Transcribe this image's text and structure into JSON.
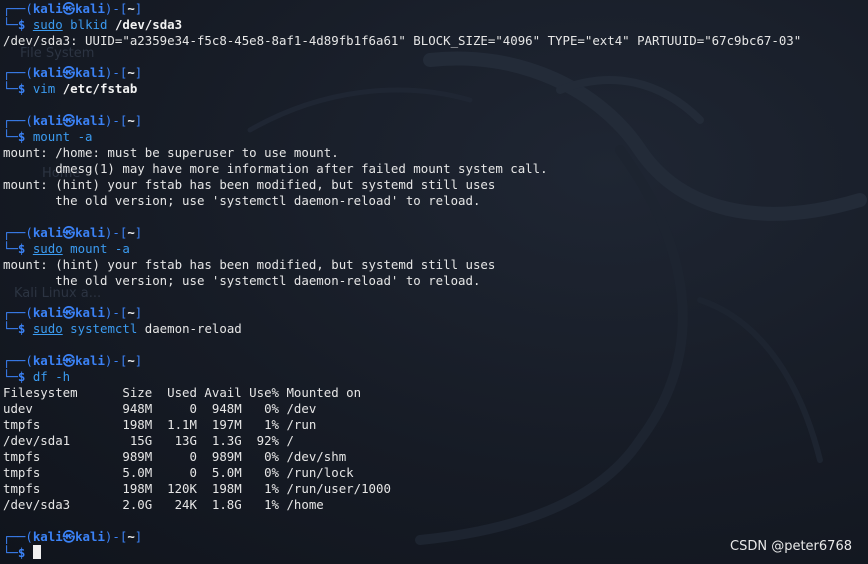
{
  "prompt": {
    "user": "kali",
    "host": "kali",
    "cwd": "~",
    "at": "㉿"
  },
  "ghost_desktop": {
    "icon_label_1": "File System",
    "icon_label_2": "Home",
    "icon_label_3": "Kali Linux a..."
  },
  "blocks": [
    {
      "sudo": "sudo",
      "cmd": "blkid",
      "arg": "/dev/sda3",
      "output": [
        "/dev/sda3: UUID=\"a2359e34-f5c8-45e8-8af1-4d89fb1f6a61\" BLOCK_SIZE=\"4096\" TYPE=\"ext4\" PARTUUID=\"67c9bc67-03\""
      ]
    },
    {
      "sudo": "",
      "cmd": "vim",
      "arg": "/etc/fstab",
      "output": []
    },
    {
      "sudo": "",
      "cmd": "mount -a",
      "arg": "",
      "output": [
        "mount: /home: must be superuser to use mount.",
        "       dmesg(1) may have more information after failed mount system call.",
        "mount: (hint) your fstab has been modified, but systemd still uses",
        "       the old version; use 'systemctl daemon-reload' to reload."
      ]
    },
    {
      "sudo": "sudo",
      "cmd": "mount -a",
      "arg": "",
      "output": [
        "mount: (hint) your fstab has been modified, but systemd still uses",
        "       the old version; use 'systemctl daemon-reload' to reload."
      ]
    },
    {
      "sudo": "sudo",
      "cmd": "systemctl",
      "arg": "daemon-reload",
      "arg_plain": true,
      "output": []
    },
    {
      "sudo": "",
      "cmd": "df -h",
      "arg": "",
      "output": [
        "Filesystem      Size  Used Avail Use% Mounted on",
        "udev            948M     0  948M   0% /dev",
        "tmpfs           198M  1.1M  197M   1% /run",
        "/dev/sda1        15G   13G  1.3G  92% /",
        "tmpfs           989M     0  989M   0% /dev/shm",
        "tmpfs           5.0M     0  5.0M   0% /run/lock",
        "tmpfs           198M  120K  198M   1% /run/user/1000",
        "/dev/sda3       2.0G   24K  1.8G   1% /home"
      ]
    }
  ],
  "watermark": "CSDN @peter6768",
  "colors": {
    "prompt_frame": "#3b82f6",
    "command": "#3b9bf0",
    "background": "#161b25"
  }
}
